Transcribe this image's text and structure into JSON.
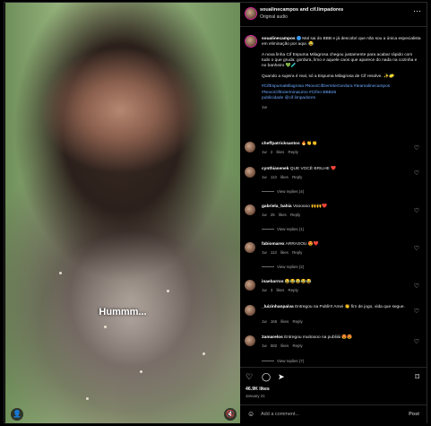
{
  "header": {
    "names": "soualinecampos and cif.limpadores",
    "audio": "Original audio",
    "more": "⋯"
  },
  "media": {
    "subtitle": "Hummm...",
    "sound_icon": "🔇",
    "tag_icon": "👤"
  },
  "caption": {
    "username": "soualinecampos",
    "line1": "Mal sai do BBB e já descobri que não sou a única especialista em eliminação por aqui. 😂",
    "line2": "A nova linha Cif Espuma Milagrosa chegou justamente para acabar rápido com tudo o que gruda: gordura, limo e aquele caos que aparece do nada na cozinha e no banheiro 💚🧪",
    "line3": "Quando a sujeira é real, só a Espuma Milagrosa de Cif resolve. ✨🧽",
    "hashtags": "#CifEspumaMilagrosa #NovoCifDerreteGordura #teamalinecampos #NovoCifExterminaLimo #Cifno BBB26",
    "partner": "publicidade @cif.limpadores",
    "time": "1w"
  },
  "comments": [
    {
      "user": "cheffpatricksantos",
      "text": "🔥👏👏",
      "time": "1w",
      "likes": "2 likes",
      "reply": "Reply",
      "view_replies": ""
    },
    {
      "user": "cynthiasenek",
      "text": "QUE VOCÊ BRILHE ❤️",
      "time": "1w",
      "likes": "113 likes",
      "reply": "Reply",
      "view_replies": "View replies (4)"
    },
    {
      "user": "gabriela_bahia",
      "text": "Voooooo 🙌🙌❤️",
      "time": "1w",
      "likes": "25 likes",
      "reply": "Reply",
      "view_replies": "View replies (1)"
    },
    {
      "user": "fabiomarex",
      "text": "ARRASOU 😍❤️",
      "time": "1w",
      "likes": "113 likes",
      "reply": "Reply",
      "view_replies": "View replies (2)"
    },
    {
      "user": "inaebarros",
      "text": "😂😂😂😂😂",
      "time": "1w",
      "likes": "3 likes",
      "reply": "Reply",
      "view_replies": ""
    },
    {
      "user": "_luizinhanpaiva",
      "text": "Entregou na Publi!!! Amei 👏 fim de jogo, vida que segue.",
      "time": "1w",
      "likes": "166 likes",
      "reply": "Reply",
      "view_replies": ""
    },
    {
      "user": "2amarelos",
      "text": "Entregou muitoooo na publiiiii 😍😍",
      "time": "1w",
      "likes": "582 likes",
      "reply": "Reply",
      "view_replies": "View replies (7)"
    }
  ],
  "actions": {
    "like_icon": "♡",
    "comment_icon": "◯",
    "share_icon": "➤",
    "save_icon": "⌑",
    "likes": "46.9K likes",
    "date": "January 21"
  },
  "add_comment": {
    "emoji_icon": "☺",
    "placeholder": "Add a comment...",
    "post": "Post"
  }
}
